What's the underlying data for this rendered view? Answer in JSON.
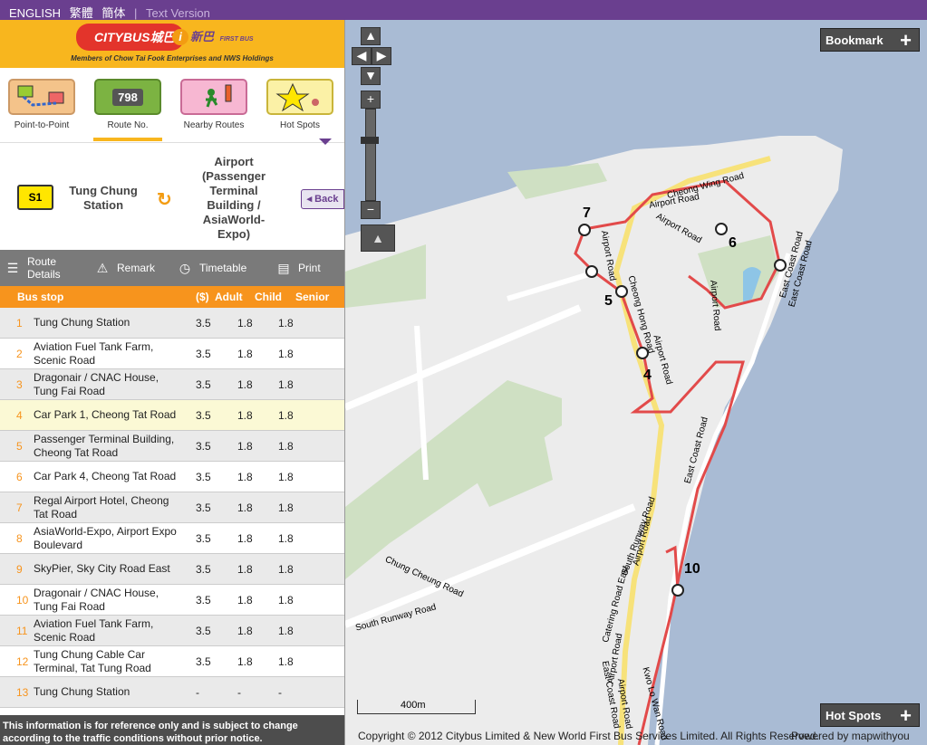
{
  "topbar": {
    "english": "ENGLISH",
    "trad": "繁體",
    "simp": "簡体",
    "sep": "|",
    "text_version": "Text Version"
  },
  "brand": {
    "citybus": "CITYBUS城巴",
    "firstbus": "新巴",
    "firstbus_sub": "FIRST BUS",
    "tagline": "Members of Chow Tai Fook Enterprises and NWS Holdings"
  },
  "tabs": [
    {
      "label": "Point-to-Point",
      "icon": "point-to-point-icon"
    },
    {
      "label": "Route No.",
      "icon": "route-number-icon",
      "icon_text": "798"
    },
    {
      "label": "Nearby Routes",
      "icon": "nearby-routes-icon"
    },
    {
      "label": "Hot Spots",
      "icon": "hot-spots-icon"
    }
  ],
  "route": {
    "number": "S1",
    "origin": "Tung Chung Station",
    "destination": "Airport (Passenger Terminal Building / AsiaWorld-Expo)",
    "back": "Back"
  },
  "toolbar": {
    "details": "Route Details",
    "remark": "Remark",
    "timetable": "Timetable",
    "print": "Print"
  },
  "table": {
    "headers": {
      "stop": "Bus stop",
      "currency": "($)",
      "adult": "Adult",
      "child": "Child",
      "senior": "Senior"
    },
    "rows": [
      {
        "n": "1",
        "name": "Tung Chung Station",
        "adult": "3.5",
        "child": "1.8",
        "senior": "1.8"
      },
      {
        "n": "2",
        "name": "Aviation Fuel Tank Farm, Scenic Road",
        "adult": "3.5",
        "child": "1.8",
        "senior": "1.8"
      },
      {
        "n": "3",
        "name": "Dragonair / CNAC House, Tung Fai Road",
        "adult": "3.5",
        "child": "1.8",
        "senior": "1.8"
      },
      {
        "n": "4",
        "name": "Car Park 1, Cheong Tat Road",
        "adult": "3.5",
        "child": "1.8",
        "senior": "1.8"
      },
      {
        "n": "5",
        "name": "Passenger Terminal Building, Cheong Tat Road",
        "adult": "3.5",
        "child": "1.8",
        "senior": "1.8"
      },
      {
        "n": "6",
        "name": "Car Park 4, Cheong Tat Road",
        "adult": "3.5",
        "child": "1.8",
        "senior": "1.8"
      },
      {
        "n": "7",
        "name": "Regal Airport Hotel, Cheong Tat Road",
        "adult": "3.5",
        "child": "1.8",
        "senior": "1.8"
      },
      {
        "n": "8",
        "name": "AsiaWorld-Expo, Airport Expo Boulevard",
        "adult": "3.5",
        "child": "1.8",
        "senior": "1.8"
      },
      {
        "n": "9",
        "name": "SkyPier, Sky City Road East",
        "adult": "3.5",
        "child": "1.8",
        "senior": "1.8"
      },
      {
        "n": "10",
        "name": "Dragonair / CNAC House, Tung Fai Road",
        "adult": "3.5",
        "child": "1.8",
        "senior": "1.8"
      },
      {
        "n": "11",
        "name": "Aviation Fuel Tank Farm, Scenic Road",
        "adult": "3.5",
        "child": "1.8",
        "senior": "1.8"
      },
      {
        "n": "12",
        "name": "Tung Chung Cable Car Terminal, Tat Tung Road",
        "adult": "3.5",
        "child": "1.8",
        "senior": "1.8"
      },
      {
        "n": "13",
        "name": "Tung Chung Station",
        "adult": "-",
        "child": "-",
        "senior": "-"
      }
    ]
  },
  "disclaimer": "This information is for reference only and is subject to change according to the traffic conditions without prior notice.",
  "map": {
    "bookmark": "Bookmark",
    "hotspots": "Hot Spots",
    "scale": "400m",
    "copyright": "Copyright © 2012 Citybus Limited & New World First Bus Services Limited. All Rights Reserved.",
    "powered": "Powered by mapwithyou",
    "roads": [
      "Cheong Wing Road",
      "Airport Road",
      "Airport Road",
      "Airport Road",
      "Cheong Hong Road",
      "Airport Road",
      "Airport Road",
      "East Coast Road",
      "East Coast Road",
      "South Runway Road",
      "Airport Road",
      "Chung Cheung Road",
      "South Runway Road",
      "Catering Road East",
      "Airport Road",
      "East Coast Road",
      "Kwo Lo Wan Road",
      "Airport Road",
      "East Coast Road"
    ],
    "markers": [
      "7",
      "6",
      "5",
      "4",
      "10"
    ],
    "colors": {
      "sea": "#a9bbd4",
      "land": "#ececec",
      "green": "#cfe0c3",
      "route": "#e24a4a",
      "road": "#f7e27a"
    }
  }
}
